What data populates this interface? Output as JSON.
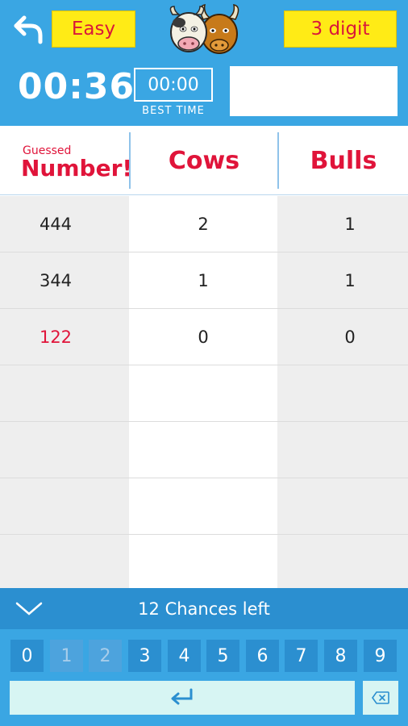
{
  "top_bar": {
    "back_icon": "back-arrow-icon",
    "difficulty_label": "Easy",
    "digits_label": "3 digit",
    "logo": "cow-bull-logo",
    "accent_color": "#3aa6e3",
    "button_color": "#ffeb16"
  },
  "timer_bar": {
    "elapsed": "00:36",
    "best_time": "00:00",
    "best_time_label": "BEST TIME",
    "guess_input_value": ""
  },
  "table": {
    "headers": {
      "guessed_small": "Guessed",
      "guessed_big": "Number!",
      "cows": "Cows",
      "bulls": "Bulls"
    },
    "header_color": "#e0143a",
    "rows": [
      {
        "guess": "444",
        "cows": "2",
        "bulls": "1",
        "highlight": false
      },
      {
        "guess": "344",
        "cows": "1",
        "bulls": "1",
        "highlight": false
      },
      {
        "guess": "122",
        "cows": "0",
        "bulls": "0",
        "highlight": true
      },
      {
        "guess": "",
        "cows": "",
        "bulls": "",
        "highlight": false
      },
      {
        "guess": "",
        "cows": "",
        "bulls": "",
        "highlight": false
      },
      {
        "guess": "",
        "cows": "",
        "bulls": "",
        "highlight": false
      },
      {
        "guess": "",
        "cows": "",
        "bulls": "",
        "highlight": false
      }
    ]
  },
  "status": {
    "collapse_icon": "chevron-down-icon",
    "chances_text": "12 Chances left"
  },
  "keypad": {
    "keys": [
      {
        "label": "0",
        "disabled": false
      },
      {
        "label": "1",
        "disabled": true
      },
      {
        "label": "2",
        "disabled": true
      },
      {
        "label": "3",
        "disabled": false
      },
      {
        "label": "4",
        "disabled": false
      },
      {
        "label": "5",
        "disabled": false
      },
      {
        "label": "6",
        "disabled": false
      },
      {
        "label": "7",
        "disabled": false
      },
      {
        "label": "8",
        "disabled": false
      },
      {
        "label": "9",
        "disabled": false
      }
    ],
    "enter_icon": "enter-icon",
    "delete_icon": "backspace-icon"
  }
}
